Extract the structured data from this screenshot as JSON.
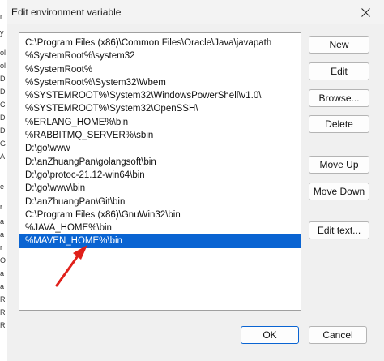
{
  "window": {
    "title": "Edit environment variable"
  },
  "background_window": {
    "fragments": [
      "r",
      "y",
      "ol",
      "ol",
      "D",
      "D",
      "C",
      "D",
      "D",
      "G",
      "A",
      "e",
      "r",
      "a",
      "a",
      "r",
      "O",
      "a",
      "a",
      "R",
      "R",
      "R"
    ]
  },
  "variable_list": {
    "items": [
      "C:\\Program Files (x86)\\Common Files\\Oracle\\Java\\javapath",
      "%SystemRoot%\\system32",
      "%SystemRoot%",
      "%SystemRoot%\\System32\\Wbem",
      "%SYSTEMROOT%\\System32\\WindowsPowerShell\\v1.0\\",
      "%SYSTEMROOT%\\System32\\OpenSSH\\",
      "%ERLANG_HOME%\\bin",
      "%RABBITMQ_SERVER%\\sbin",
      "D:\\go\\www",
      "D:\\anZhuangPan\\golangsoft\\bin",
      "D:\\go\\protoc-21.12-win64\\bin",
      "D:\\go\\www\\bin",
      "D:\\anZhuangPan\\Git\\bin",
      "C:\\Program Files (x86)\\GnuWin32\\bin",
      "%JAVA_HOME%\\bin",
      "%MAVEN_HOME%\\bin"
    ],
    "selected_index": 15
  },
  "buttons": {
    "new": "New",
    "edit": "Edit",
    "browse": "Browse...",
    "delete": "Delete",
    "move_up": "Move Up",
    "move_down": "Move Down",
    "edit_text": "Edit text...",
    "ok": "OK",
    "cancel": "Cancel"
  },
  "colors": {
    "selection": "#0a64d2",
    "arrow": "#e0201a"
  }
}
